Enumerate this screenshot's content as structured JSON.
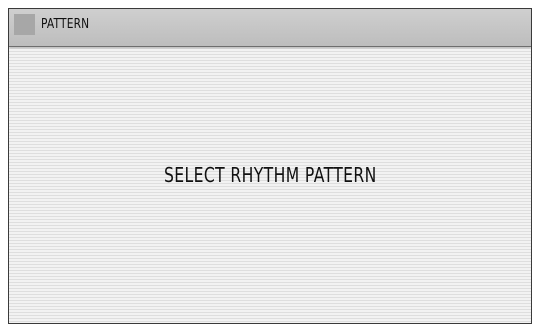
{
  "window": {
    "title": "PATTERN"
  },
  "main": {
    "message": "SELECT RHYTHM PATTERN"
  }
}
